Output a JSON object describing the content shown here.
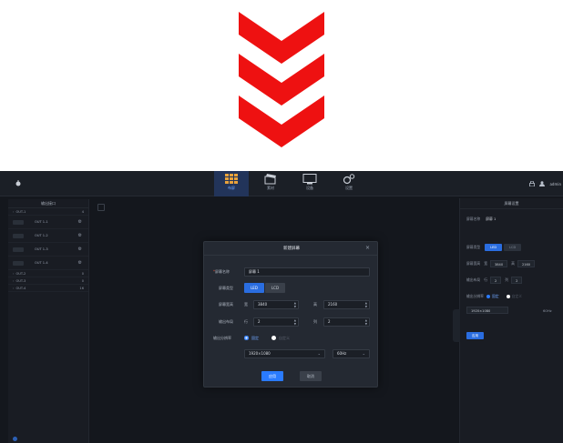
{
  "colors": {
    "chevron": "#ee1111",
    "accent": "#2a7bff",
    "app_bg": "#14171d"
  },
  "topbar": {
    "nav": [
      {
        "icon": "layout-grid-icon",
        "label": "布屏"
      },
      {
        "icon": "media-icon",
        "label": "素材"
      },
      {
        "icon": "monitor-icon",
        "label": "设备"
      },
      {
        "icon": "gears-icon",
        "label": "设置"
      }
    ],
    "user": "admin"
  },
  "left_panel": {
    "title": "输出接口",
    "outputs": [
      {
        "name": "OUT-1",
        "count": "4"
      },
      {
        "name": "OUT-2",
        "count": "0"
      },
      {
        "name": "OUT-3",
        "count": "0"
      },
      {
        "name": "OUT-4",
        "count": "16"
      }
    ],
    "sub_items": [
      "OUT 1-1",
      "OUT 1-2",
      "OUT 1-3",
      "OUT 1-4"
    ]
  },
  "right_panel": {
    "title": "屏幕设置",
    "name_label": "屏幕名称",
    "name_value": "屏幕 1",
    "type_label": "屏幕类型",
    "type_led": "LED",
    "type_lcd": "LCD",
    "res_label": "屏幕宽高",
    "width_prefix": "宽",
    "width_value": "3840",
    "height_prefix": "高",
    "height_value": "2160",
    "layout_label": "输出布局",
    "rows_prefix": "行",
    "rows_value": "2",
    "cols_prefix": "列",
    "cols_value": "2",
    "out_res_label": "输出分辨率",
    "out_res_fixed": "固定",
    "out_res_custom": "自定义",
    "resolution": "1920×1080",
    "refresh": "60Hz",
    "apply": "应用"
  },
  "dialog": {
    "title": "新建屏幕",
    "close": "×",
    "name_label": "屏幕名称",
    "name_value": "屏幕 1",
    "type_label": "屏幕类型",
    "type_led": "LED",
    "type_lcd": "LCD",
    "res_label": "屏幕宽高",
    "width_prefix": "宽",
    "width_value": "3840",
    "height_prefix": "高",
    "height_value": "2160",
    "layout_label": "输出布局",
    "rows_prefix": "行",
    "rows_value": "2",
    "cols_prefix": "列",
    "cols_value": "2",
    "out_res_label": "输出分辨率",
    "out_res_fixed": "固定",
    "out_res_custom": "自定义",
    "resolution": "1920×1080",
    "refresh": "60Hz",
    "apply": "应用",
    "cancel": "取消"
  }
}
